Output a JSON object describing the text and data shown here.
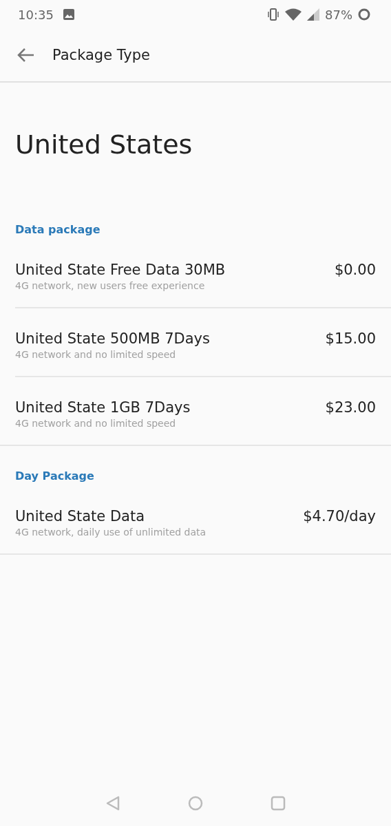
{
  "status_bar": {
    "time": "10:35",
    "battery": "87%"
  },
  "app_bar": {
    "title": "Package Type"
  },
  "country": "United States",
  "sections": [
    {
      "header": "Data package",
      "packages": [
        {
          "name": "United State Free Data 30MB",
          "description": "4G network, new users free experience",
          "price": "$0.00"
        },
        {
          "name": "United State 500MB 7Days",
          "description": "4G network and no limited speed",
          "price": "$15.00"
        },
        {
          "name": "United State 1GB 7Days",
          "description": "4G network and no limited speed",
          "price": "$23.00"
        }
      ]
    },
    {
      "header": "Day Package",
      "packages": [
        {
          "name": "United State Data",
          "description": "4G network, daily use of unlimited data",
          "price": "$4.70/day"
        }
      ]
    }
  ]
}
